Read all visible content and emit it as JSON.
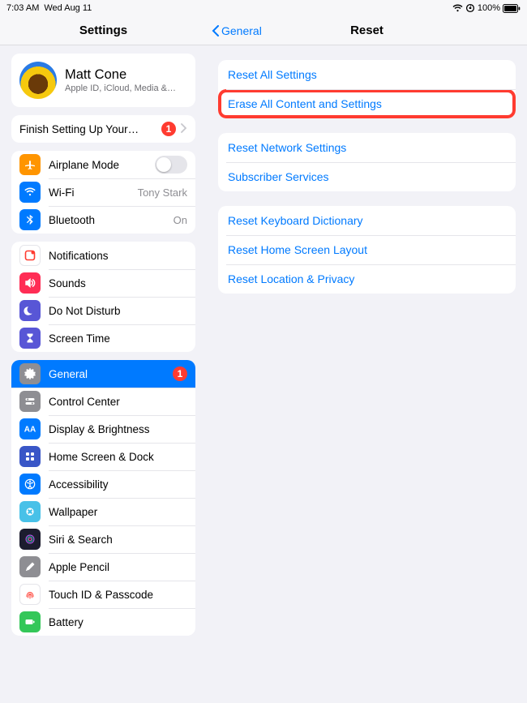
{
  "status": {
    "time": "7:03 AM",
    "date": "Wed Aug 11",
    "battery_pct": "100%"
  },
  "sidebar": {
    "title": "Settings",
    "account": {
      "name": "Matt Cone",
      "subtitle": "Apple ID, iCloud, Media &…"
    },
    "setup": {
      "label": "Finish Setting Up Your…",
      "badge": "1"
    },
    "group_connectivity": {
      "airplane": "Airplane Mode",
      "wifi": "Wi-Fi",
      "wifi_value": "Tony Stark",
      "bluetooth": "Bluetooth",
      "bluetooth_value": "On"
    },
    "group_notif": {
      "notifications": "Notifications",
      "sounds": "Sounds",
      "dnd": "Do Not Disturb",
      "screentime": "Screen Time"
    },
    "group_general": {
      "general": "General",
      "general_badge": "1",
      "control_center": "Control Center",
      "display": "Display & Brightness",
      "homescreen": "Home Screen & Dock",
      "accessibility": "Accessibility",
      "wallpaper": "Wallpaper",
      "siri": "Siri & Search",
      "pencil": "Apple Pencil",
      "touchid": "Touch ID & Passcode",
      "battery": "Battery"
    }
  },
  "detail": {
    "back_label": "General",
    "title": "Reset",
    "group1": {
      "reset_all": "Reset All Settings",
      "erase_all": "Erase All Content and Settings"
    },
    "group2": {
      "network": "Reset Network Settings",
      "subscriber": "Subscriber Services"
    },
    "group3": {
      "keyboard": "Reset Keyboard Dictionary",
      "home": "Reset Home Screen Layout",
      "location": "Reset Location & Privacy"
    }
  }
}
